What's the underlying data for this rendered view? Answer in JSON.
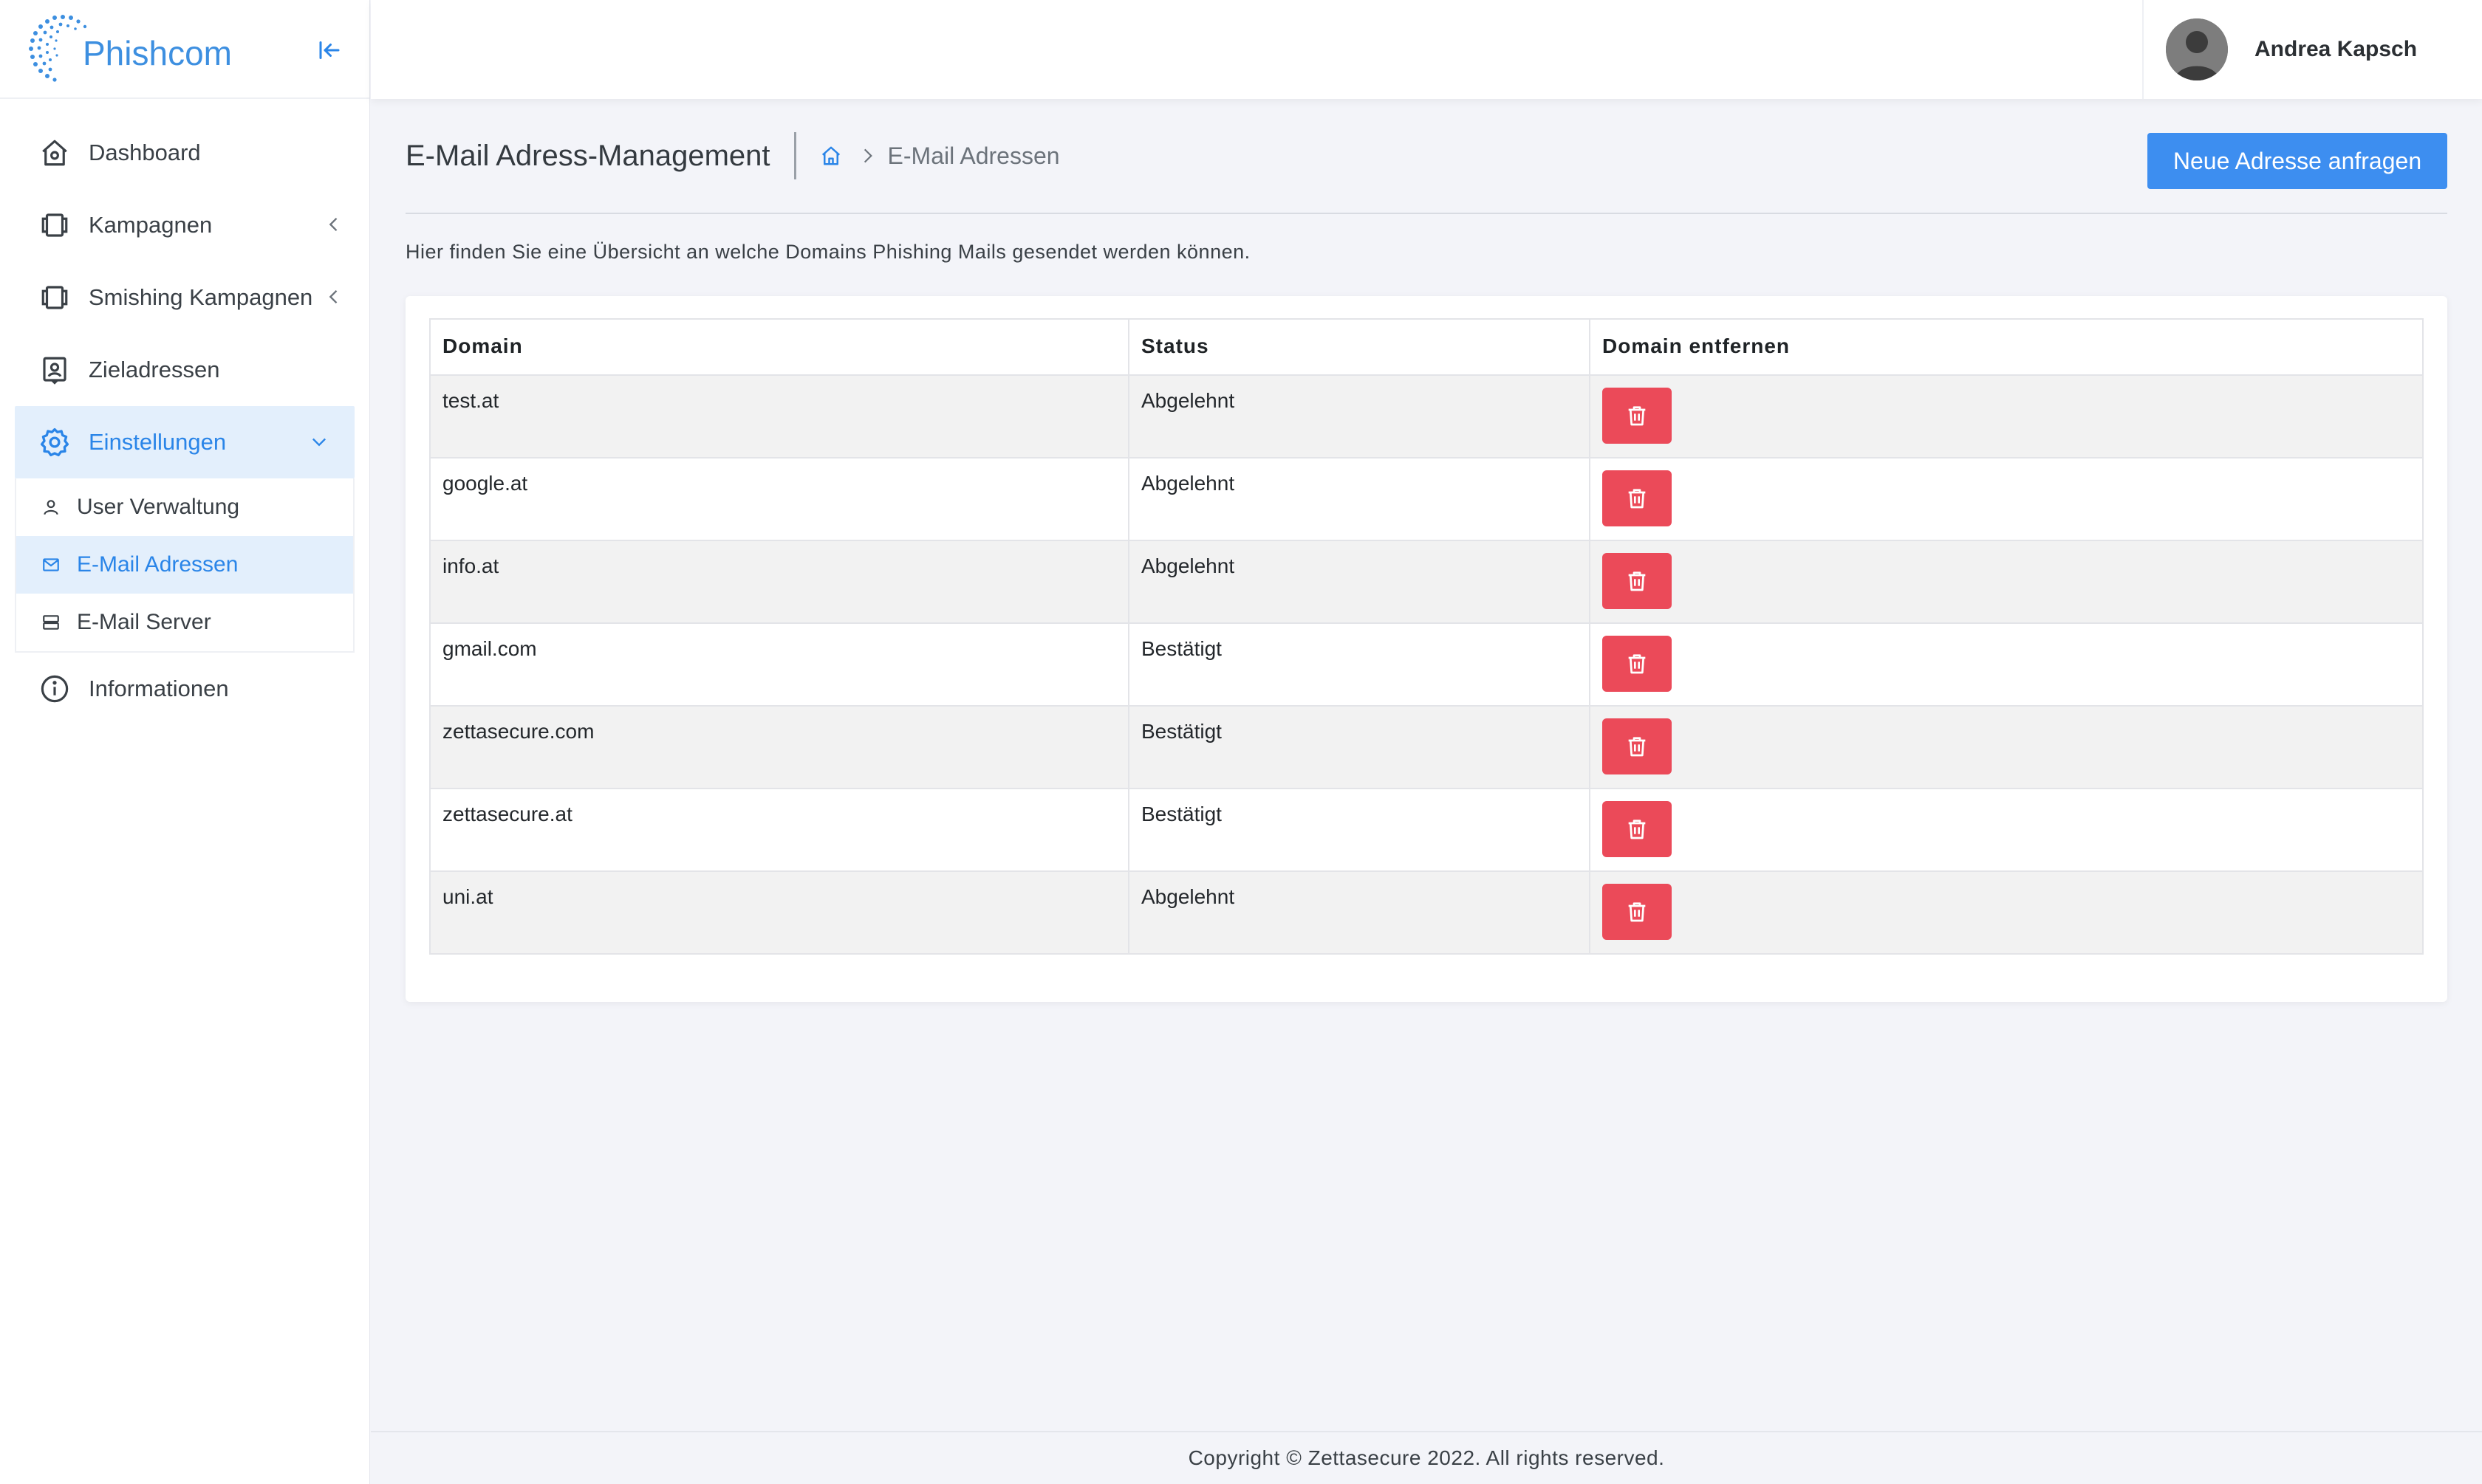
{
  "app": {
    "logo_text": "Phishcom"
  },
  "sidebar": {
    "items": [
      {
        "label": "Dashboard",
        "icon": "home-icon"
      },
      {
        "label": "Kampagnen",
        "icon": "campaign-icon"
      },
      {
        "label": "Smishing Kampagnen",
        "icon": "campaign-icon"
      },
      {
        "label": "Zieladressen",
        "icon": "contact-icon"
      },
      {
        "label": "Einstellungen",
        "icon": "gear-icon"
      },
      {
        "label": "Informationen",
        "icon": "info-icon"
      }
    ],
    "settings_sub": [
      {
        "label": "User Verwaltung",
        "icon": "user-icon"
      },
      {
        "label": "E-Mail Adressen",
        "icon": "mail-icon"
      },
      {
        "label": "E-Mail Server",
        "icon": "server-icon"
      }
    ]
  },
  "topbar": {
    "user_name": "Andrea Kapsch"
  },
  "page": {
    "title": "E-Mail Adress-Management",
    "breadcrumb_current": "E-Mail Adressen",
    "new_button": "Neue Adresse anfragen",
    "intro": "Hier finden Sie eine Übersicht an welche Domains Phishing Mails gesendet werden können."
  },
  "table": {
    "headers": [
      "Domain",
      "Status",
      "Domain entfernen"
    ],
    "rows": [
      {
        "domain": "test.at",
        "status": "Abgelehnt"
      },
      {
        "domain": "google.at",
        "status": "Abgelehnt"
      },
      {
        "domain": "info.at",
        "status": "Abgelehnt"
      },
      {
        "domain": "gmail.com",
        "status": "Bestätigt"
      },
      {
        "domain": "zettasecure.com",
        "status": "Bestätigt"
      },
      {
        "domain": "zettasecure.at",
        "status": "Bestätigt"
      },
      {
        "domain": "uni.at",
        "status": "Abgelehnt"
      }
    ]
  },
  "footer": {
    "text": "Copyright © Zettasecure 2022. All rights reserved."
  },
  "colors": {
    "accent": "#2a85e8",
    "primary_button": "#3d8ef0",
    "danger": "#eb4a59"
  }
}
